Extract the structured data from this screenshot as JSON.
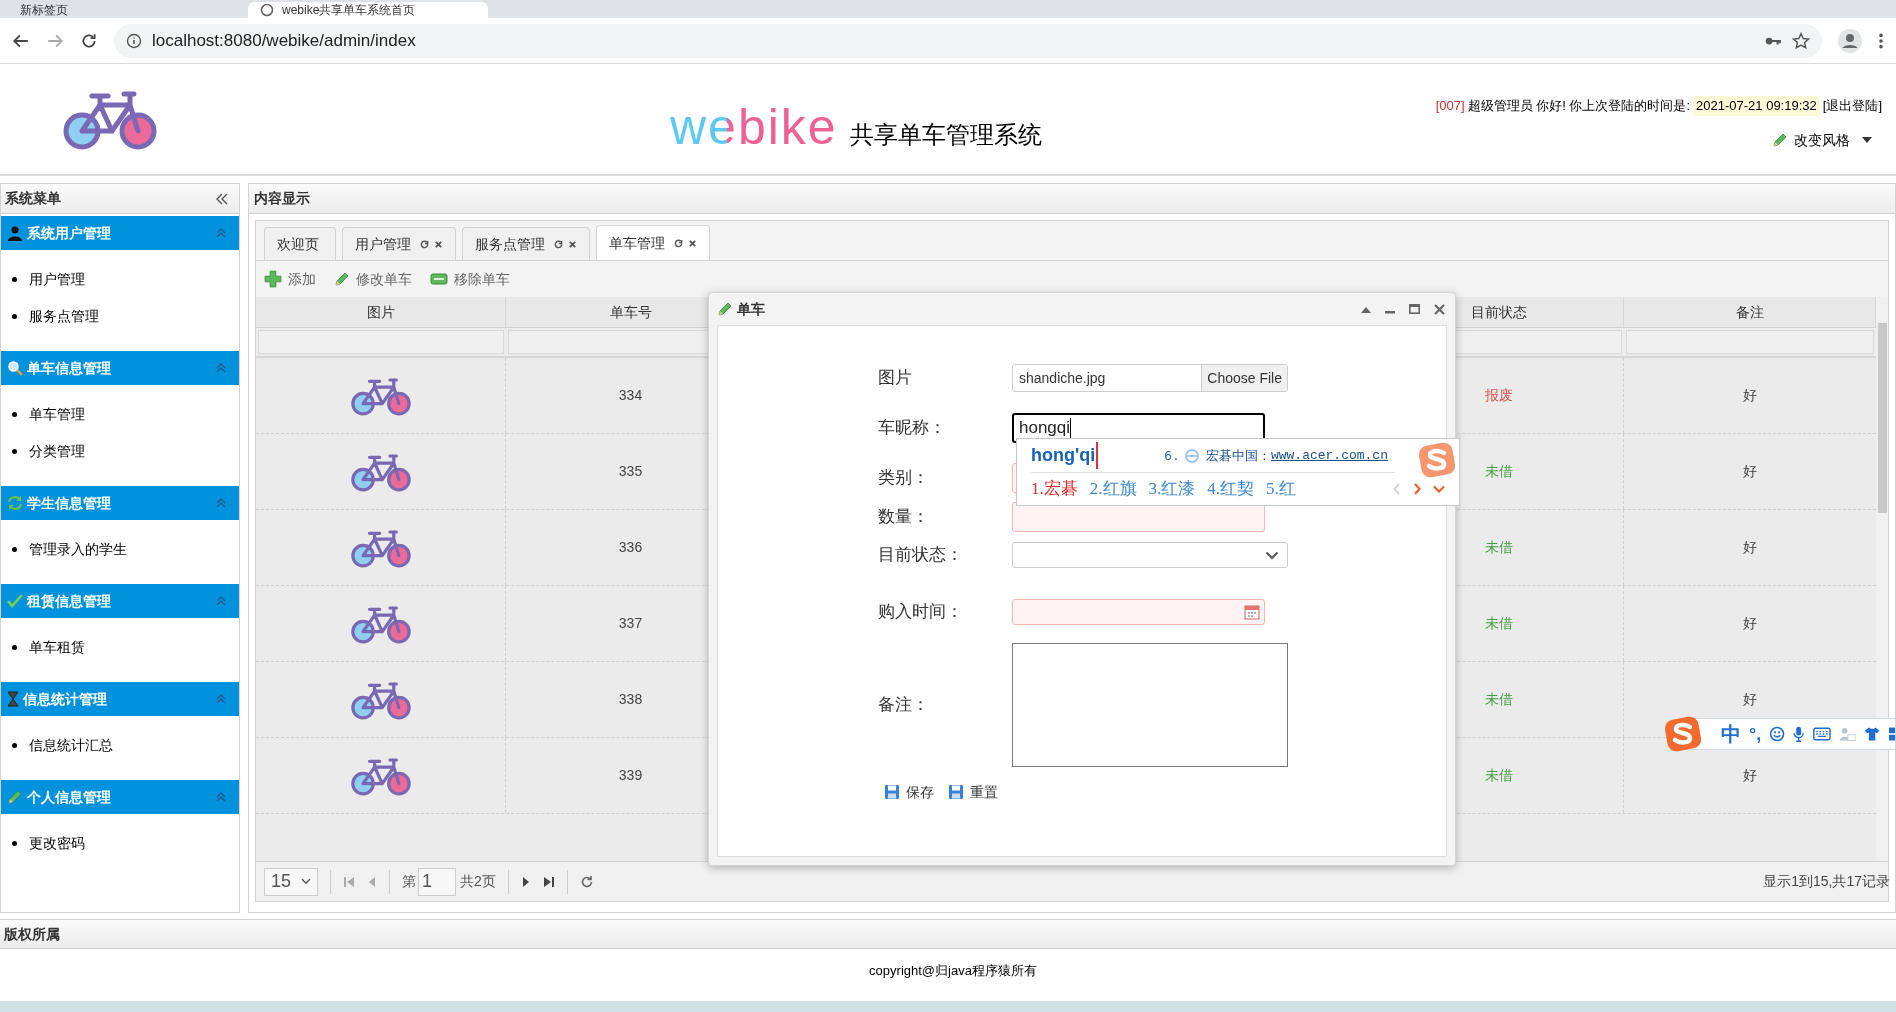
{
  "browser": {
    "tabs": [
      {
        "label": "新标签页",
        "selected": false
      },
      {
        "label": "webike共享单车系统首页",
        "selected": true
      }
    ],
    "address": "localhost:8080/webike/admin/index"
  },
  "header": {
    "logo_text": "webike",
    "subtitle": "共享单车管理系统",
    "user_id": "[007]",
    "greeting": "超级管理员 你好! 你上次登陆的时间是:",
    "last_login": "2021-07-21 09:19:32",
    "logout": "[退出登陆]",
    "style_menu": "改变风格"
  },
  "sidebar": {
    "title": "系统菜单",
    "groups": [
      {
        "title": "系统用户管理",
        "kind": "user",
        "items": [
          "用户管理",
          "服务点管理"
        ]
      },
      {
        "title": "单车信息管理",
        "kind": "search",
        "items": [
          "单车管理",
          "分类管理"
        ]
      },
      {
        "title": "学生信息管理",
        "kind": "refresh",
        "items": [
          "管理录入的学生"
        ]
      },
      {
        "title": "租赁信息管理",
        "kind": "check",
        "items": [
          "单车租赁"
        ]
      },
      {
        "title": "信息统计管理",
        "kind": "hourglass",
        "items": [
          "信息统计汇总"
        ]
      },
      {
        "title": "个人信息管理",
        "kind": "pencil",
        "items": [
          "更改密码"
        ]
      }
    ]
  },
  "content": {
    "title": "内容显示",
    "tabs": [
      {
        "label": "欢迎页",
        "closable": false,
        "selected": false
      },
      {
        "label": "用户管理",
        "closable": true,
        "selected": false
      },
      {
        "label": "服务点管理",
        "closable": true,
        "selected": false
      },
      {
        "label": "单车管理",
        "closable": true,
        "selected": true
      }
    ],
    "toolbar": [
      {
        "label": "添加",
        "kind": "add"
      },
      {
        "label": "修改单车",
        "kind": "edit"
      },
      {
        "label": "移除单车",
        "kind": "remove"
      }
    ],
    "table": {
      "columns": [
        "图片",
        "单车号",
        "目前状态",
        "备注"
      ],
      "rows": [
        {
          "number": "334",
          "status": "报废",
          "kind": "scrapped",
          "remark": "好"
        },
        {
          "number": "335",
          "status": "未借",
          "kind": "available",
          "remark": "好"
        },
        {
          "number": "336",
          "status": "未借",
          "kind": "available",
          "remark": "好"
        },
        {
          "number": "337",
          "status": "未借",
          "kind": "available",
          "remark": "好"
        },
        {
          "number": "338",
          "status": "未借",
          "kind": "available",
          "remark": "好"
        },
        {
          "number": "339",
          "status": "未借",
          "kind": "available",
          "remark": "好"
        }
      ]
    },
    "pager": {
      "page_size": "15",
      "page_prefix": "第",
      "page": "1",
      "total_pages": "共2页",
      "summary": "显示1到15,共17记录"
    }
  },
  "dialog": {
    "title": "单车",
    "fields": [
      {
        "label": "图片",
        "kind": "file",
        "value": "shandiche.jpg",
        "button": "Choose File"
      },
      {
        "label": "车昵称：",
        "kind": "text",
        "value": "hongqi",
        "focused": true,
        "invalid": false
      },
      {
        "label": "类别：",
        "kind": "text",
        "focused": false,
        "invalid": true
      },
      {
        "label": "数量：",
        "kind": "text",
        "focused": false,
        "invalid": true
      },
      {
        "label": "目前状态：",
        "kind": "select"
      },
      {
        "label": "购入时间：",
        "kind": "date",
        "invalid": true
      },
      {
        "label": "备注：",
        "kind": "textarea"
      }
    ],
    "buttons": [
      "保存",
      "重置"
    ]
  },
  "ime": {
    "composition": "hong'qi",
    "hint_number": "6.",
    "hint_text": "宏碁中国：",
    "hint_link": "www.acer.com.cn",
    "candidates": [
      {
        "label": "1.宏碁",
        "selected": true
      },
      {
        "label": "2.红旗",
        "selected": false
      },
      {
        "label": "3.红漆",
        "selected": false
      },
      {
        "label": "4.红契",
        "selected": false
      },
      {
        "label": "5.红",
        "selected": false
      }
    ]
  },
  "ime_toolbar": {
    "mode": "中",
    "punctuation": "°,"
  },
  "footer": {
    "title": "版权所属",
    "copyright": "copyright@归java程序猿所有"
  }
}
